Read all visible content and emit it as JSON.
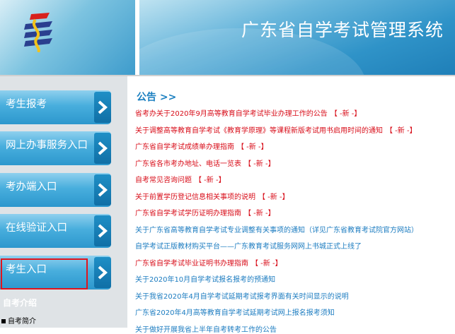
{
  "header": {
    "title": "广东省自学考试管理系统",
    "logo_icon": "education-exam-logo"
  },
  "sidebar": {
    "items": [
      {
        "label": "考生报考"
      },
      {
        "label": "网上办事服务入口"
      },
      {
        "label": "考办端入口"
      },
      {
        "label": "在线验证入口"
      },
      {
        "label": "考生入口"
      }
    ],
    "intro_title": "自考介绍",
    "intro_items": [
      {
        "label": "自考简介"
      }
    ]
  },
  "main": {
    "section_title": "公告 >>",
    "new_tag": "【 -新 -】",
    "notices": [
      {
        "text": "省考办关于2020年9月高等教育自学考试毕业办理工作的公告",
        "color": "red",
        "new": true
      },
      {
        "text": "关于调整高等教育自学考试《教育学原理》等课程新版考试用书启用时间的通知",
        "color": "red",
        "new": true
      },
      {
        "text": "广东省自学考试成绩单办理指南",
        "color": "red",
        "new": true
      },
      {
        "text": "广东省各市考办地址、电话一览表",
        "color": "red",
        "new": true
      },
      {
        "text": "自考常见咨询问题",
        "color": "red",
        "new": true
      },
      {
        "text": "关于前置学历登记信息相关事项的说明",
        "color": "red",
        "new": true
      },
      {
        "text": "广东省自学考试学历证明办理指南",
        "color": "red",
        "new": true
      },
      {
        "text": "关于广东省高等教育自学考试专业调整有关事项的通知（详见广东省教育考试院官方网站）",
        "color": "blue",
        "new": false
      },
      {
        "text": "自学考试正版教材购买平台——广东教育考试服务网网上书城正式上线了",
        "color": "blue",
        "new": false
      },
      {
        "text": "广东省自学考试毕业证明书办理指南",
        "color": "red",
        "new": true
      },
      {
        "text": "关于2020年10月自学考试报名报考的预通知",
        "color": "blue",
        "new": false
      },
      {
        "text": "关于我省2020年4月自学考试延期考试报考界面有关时间显示的说明",
        "color": "blue",
        "new": false
      },
      {
        "text": "广东省2020年4月高等教育自学考试延期考试网上报名报考须知",
        "color": "blue",
        "new": false
      },
      {
        "text": "关于做好开展我省上半年自考转考工作的公告",
        "color": "blue",
        "new": false
      }
    ]
  },
  "colors": {
    "accent_blue": "#2c97cd",
    "notice_red": "#d80c18",
    "notice_blue": "#1c7cc0",
    "highlight_red": "#e0141d"
  }
}
